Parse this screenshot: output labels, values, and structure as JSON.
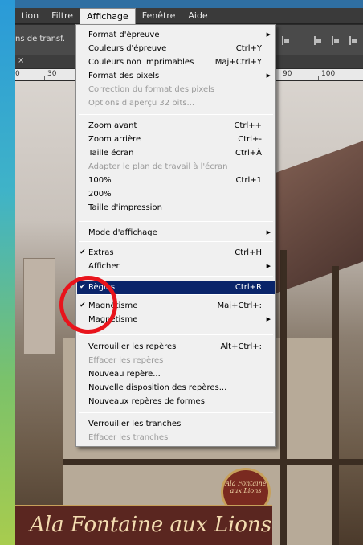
{
  "menubar": {
    "items": [
      "tion",
      "Filtre",
      "Affichage",
      "Fenêtre",
      "Aide"
    ],
    "active_index": 2
  },
  "options_bar": {
    "label": "ns de transf."
  },
  "ruler": {
    "labels": [
      "0",
      "30",
      "90",
      "100"
    ]
  },
  "document_tab": {
    "close_label": "×"
  },
  "menu": {
    "title": "Affichage",
    "items": [
      {
        "label": "Format d'épreuve",
        "shortcut": "",
        "submenu": true,
        "checked": false,
        "disabled": false,
        "highlighted": false
      },
      {
        "label": "Couleurs d'épreuve",
        "shortcut": "Ctrl+Y",
        "submenu": false,
        "checked": false,
        "disabled": false,
        "highlighted": false
      },
      {
        "label": "Couleurs non imprimables",
        "shortcut": "Maj+Ctrl+Y",
        "submenu": false,
        "checked": false,
        "disabled": false,
        "highlighted": false
      },
      {
        "label": "Format des pixels",
        "shortcut": "",
        "submenu": true,
        "checked": false,
        "disabled": false,
        "highlighted": false
      },
      {
        "label": "Correction du format des pixels",
        "shortcut": "",
        "submenu": false,
        "checked": false,
        "disabled": true,
        "highlighted": false
      },
      {
        "label": "Options d'aperçu 32 bits...",
        "shortcut": "",
        "submenu": false,
        "checked": false,
        "disabled": true,
        "highlighted": false
      },
      {
        "label": "Zoom avant",
        "shortcut": "Ctrl++",
        "submenu": false,
        "checked": false,
        "disabled": false,
        "highlighted": false
      },
      {
        "label": "Zoom arrière",
        "shortcut": "Ctrl+-",
        "submenu": false,
        "checked": false,
        "disabled": false,
        "highlighted": false
      },
      {
        "label": "Taille écran",
        "shortcut": "Ctrl+À",
        "submenu": false,
        "checked": false,
        "disabled": false,
        "highlighted": false
      },
      {
        "label": "Adapter le plan de travail à l'écran",
        "shortcut": "",
        "submenu": false,
        "checked": false,
        "disabled": true,
        "highlighted": false
      },
      {
        "label": "100%",
        "shortcut": "Ctrl+1",
        "submenu": false,
        "checked": false,
        "disabled": false,
        "highlighted": false
      },
      {
        "label": "200%",
        "shortcut": "",
        "submenu": false,
        "checked": false,
        "disabled": false,
        "highlighted": false
      },
      {
        "label": "Taille d'impression",
        "shortcut": "",
        "submenu": false,
        "checked": false,
        "disabled": false,
        "highlighted": false
      },
      {
        "label": "Mode d'affichage",
        "shortcut": "",
        "submenu": true,
        "checked": false,
        "disabled": false,
        "highlighted": false
      },
      {
        "label": "Extras",
        "shortcut": "Ctrl+H",
        "submenu": false,
        "checked": true,
        "disabled": false,
        "highlighted": false
      },
      {
        "label": "Afficher",
        "shortcut": "",
        "submenu": true,
        "checked": false,
        "disabled": false,
        "highlighted": false
      },
      {
        "label": "Règles",
        "shortcut": "Ctrl+R",
        "submenu": false,
        "checked": true,
        "disabled": false,
        "highlighted": true
      },
      {
        "label": "Magnétisme",
        "shortcut": "Maj+Ctrl+:",
        "submenu": false,
        "checked": true,
        "disabled": false,
        "highlighted": false
      },
      {
        "label": "Magnétisme",
        "shortcut": "",
        "submenu": true,
        "checked": false,
        "disabled": false,
        "highlighted": false
      },
      {
        "label": "Verrouiller les repères",
        "shortcut": "Alt+Ctrl+:",
        "submenu": false,
        "checked": false,
        "disabled": false,
        "highlighted": false
      },
      {
        "label": "Effacer les repères",
        "shortcut": "",
        "submenu": false,
        "checked": false,
        "disabled": true,
        "highlighted": false
      },
      {
        "label": "Nouveau repère...",
        "shortcut": "",
        "submenu": false,
        "checked": false,
        "disabled": false,
        "highlighted": false
      },
      {
        "label": "Nouvelle disposition des repères...",
        "shortcut": "",
        "submenu": false,
        "checked": false,
        "disabled": false,
        "highlighted": false
      },
      {
        "label": "Nouveaux repères de formes",
        "shortcut": "",
        "submenu": false,
        "checked": false,
        "disabled": false,
        "highlighted": false
      },
      {
        "label": "Verrouiller les tranches",
        "shortcut": "",
        "submenu": false,
        "checked": false,
        "disabled": false,
        "highlighted": false
      },
      {
        "label": "Effacer les tranches",
        "shortcut": "",
        "submenu": false,
        "checked": false,
        "disabled": true,
        "highlighted": false
      }
    ]
  },
  "photo": {
    "sign_text": "Ala Fontaine aux Lions",
    "oval_sign_text": [
      "Ala Fontaine",
      "aux Lions"
    ]
  },
  "icons": {
    "check": "check-icon",
    "submenu": "submenu-arrow-icon"
  },
  "colors": {
    "highlight": "#0a246a",
    "annotation": "#e8141c"
  }
}
